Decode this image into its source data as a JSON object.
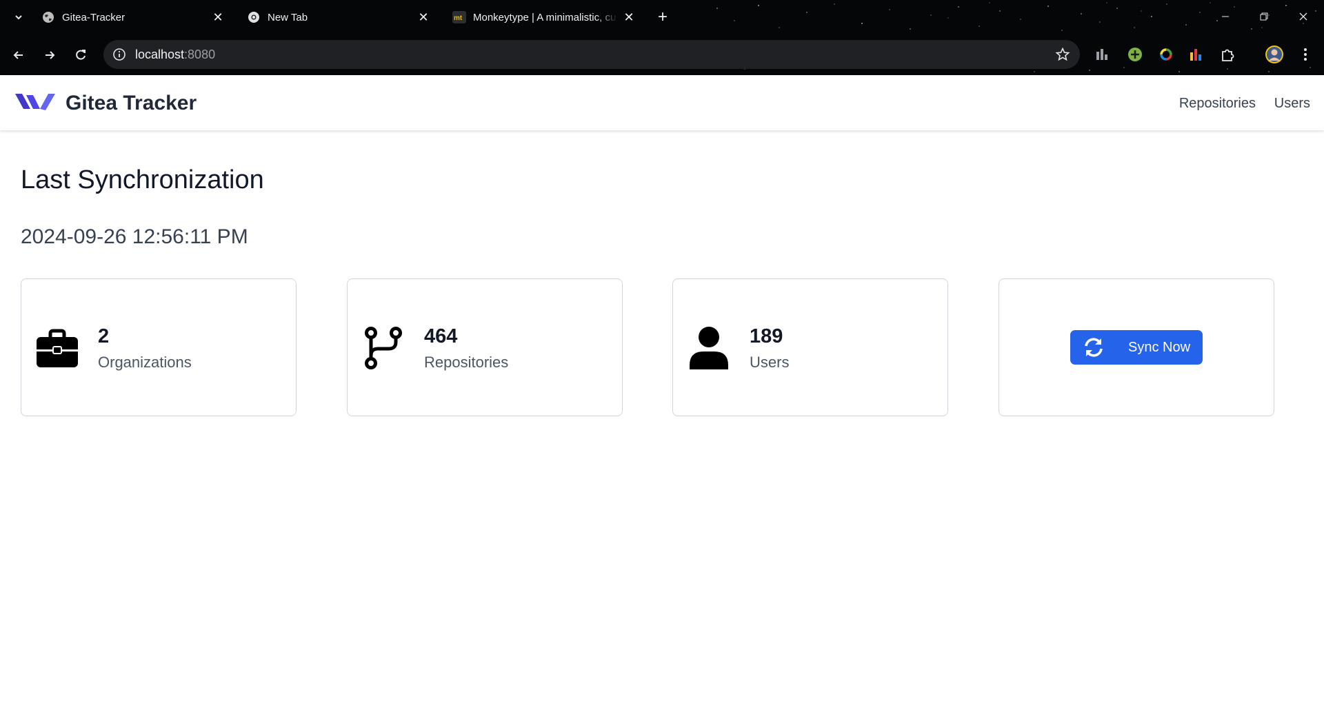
{
  "browser": {
    "tabs": [
      {
        "title": "Gitea-Tracker",
        "icon": "globe-icon"
      },
      {
        "title": "New Tab",
        "icon": "chrome-icon"
      },
      {
        "title": "Monkeytype | A minimalistic, cu",
        "icon": "monkeytype-icon"
      }
    ],
    "url_host": "localhost",
    "url_port": ":8080"
  },
  "app": {
    "brand": "Gitea Tracker",
    "brand_color": "#4f46e5",
    "nav": {
      "repositories": "Repositories",
      "users": "Users"
    }
  },
  "main": {
    "title": "Last Synchronization",
    "timestamp": "2024-09-26 12:56:11 PM",
    "stats": [
      {
        "count": "2",
        "label": "Organizations",
        "icon": "briefcase-icon"
      },
      {
        "count": "464",
        "label": "Repositories",
        "icon": "git-branch-icon"
      },
      {
        "count": "189",
        "label": "Users",
        "icon": "user-icon"
      }
    ],
    "sync_button": {
      "label": "Sync Now",
      "icon": "sync-icon",
      "color": "#2563eb"
    }
  }
}
